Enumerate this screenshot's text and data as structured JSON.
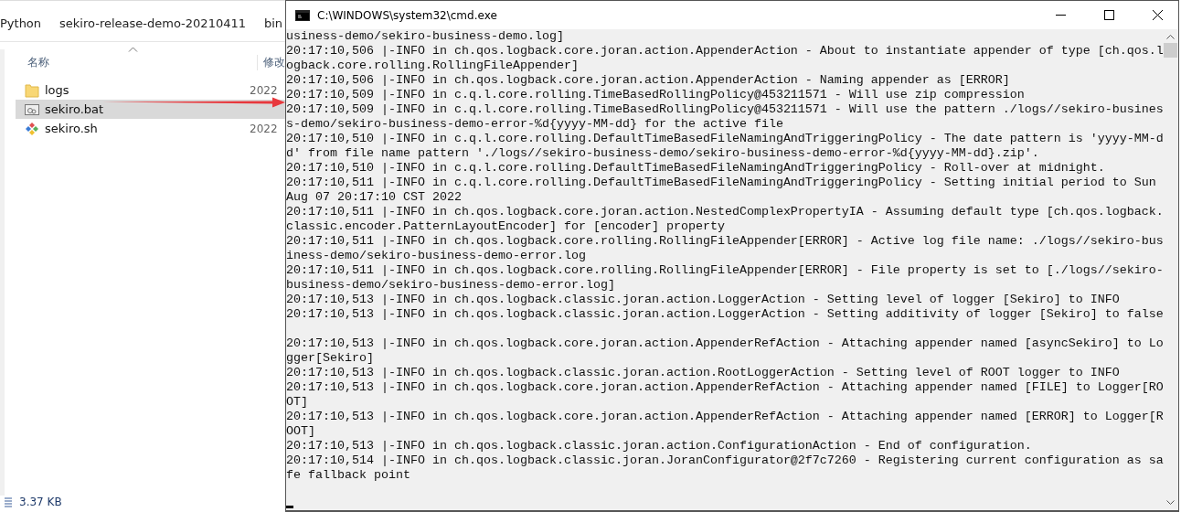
{
  "explorer": {
    "breadcrumb": [
      "Python",
      "sekiro-release-demo-20210411",
      "bin"
    ],
    "columns": [
      "名称",
      "修改"
    ],
    "files": [
      {
        "kind": "folder",
        "name": "logs",
        "date": "2022",
        "selected": false
      },
      {
        "kind": "bat",
        "name": "sekiro.bat",
        "selected": true
      },
      {
        "kind": "sh",
        "name": "sekiro.sh",
        "date": "2022",
        "selected": false
      }
    ],
    "status_bar": "3.37 KB"
  },
  "console": {
    "title": "C:\\WINDOWS\\system32\\cmd.exe",
    "lines": [
      {
        "kind": "text",
        "text": "usiness-demo/sekiro-business-demo.log]"
      },
      {
        "kind": "text",
        "text": "20:17:10,506 |-INFO in ch.qos.logback.core.joran.action.AppenderAction - About to instantiate appender of type [ch.qos.l"
      },
      {
        "kind": "text",
        "text": "ogback.core.rolling.RollingFileAppender]"
      },
      {
        "kind": "text",
        "text": "20:17:10,506 |-INFO in ch.qos.logback.core.joran.action.AppenderAction - Naming appender as [ERROR]"
      },
      {
        "kind": "text",
        "text": "20:17:10,509 |-INFO in c.q.l.core.rolling.TimeBasedRollingPolicy@453211571 - Will use zip compression"
      },
      {
        "kind": "text",
        "text": "20:17:10,509 |-INFO in c.q.l.core.rolling.TimeBasedRollingPolicy@453211571 - Will use the pattern ./logs//sekiro-busines"
      },
      {
        "kind": "text",
        "text": "s-demo/sekiro-business-demo-error-%d{yyyy-MM-dd} for the active file"
      },
      {
        "kind": "text",
        "text": "20:17:10,510 |-INFO in c.q.l.core.rolling.DefaultTimeBasedFileNamingAndTriggeringPolicy - The date pattern is 'yyyy-MM-d"
      },
      {
        "kind": "text",
        "text": "d' from file name pattern './logs//sekiro-business-demo/sekiro-business-demo-error-%d{yyyy-MM-dd}.zip'."
      },
      {
        "kind": "text",
        "text": "20:17:10,510 |-INFO in c.q.l.core.rolling.DefaultTimeBasedFileNamingAndTriggeringPolicy - Roll-over at midnight."
      },
      {
        "kind": "text",
        "text": "20:17:10,511 |-INFO in c.q.l.core.rolling.DefaultTimeBasedFileNamingAndTriggeringPolicy - Setting initial period to Sun"
      },
      {
        "kind": "text",
        "text": "Aug 07 20:17:10 CST 2022"
      },
      {
        "kind": "text",
        "text": "20:17:10,511 |-INFO in ch.qos.logback.core.joran.action.NestedComplexPropertyIA - Assuming default type [ch.qos.logback."
      },
      {
        "kind": "text",
        "text": "classic.encoder.PatternLayoutEncoder] for [encoder] property"
      },
      {
        "kind": "text",
        "text": "20:17:10,511 |-INFO in ch.qos.logback.core.rolling.RollingFileAppender[ERROR] - Active log file name: ./logs//sekiro-bus"
      },
      {
        "kind": "text",
        "text": "iness-demo/sekiro-business-demo-error.log"
      },
      {
        "kind": "text",
        "text": "20:17:10,511 |-INFO in ch.qos.logback.core.rolling.RollingFileAppender[ERROR] - File property is set to [./logs//sekiro-"
      },
      {
        "kind": "text",
        "text": "business-demo/sekiro-business-demo-error.log]"
      },
      {
        "kind": "text",
        "text": "20:17:10,513 |-INFO in ch.qos.logback.classic.joran.action.LoggerAction - Setting level of logger [Sekiro] to INFO"
      },
      {
        "kind": "text",
        "text": "20:17:10,513 |-INFO in ch.qos.logback.classic.joran.action.LoggerAction - Setting additivity of logger [Sekiro] to false"
      },
      {
        "kind": "blank"
      },
      {
        "kind": "text",
        "text": "20:17:10,513 |-INFO in ch.qos.logback.core.joran.action.AppenderRefAction - Attaching appender named [asyncSekiro] to Lo"
      },
      {
        "kind": "text",
        "text": "gger[Sekiro]"
      },
      {
        "kind": "text",
        "text": "20:17:10,513 |-INFO in ch.qos.logback.classic.joran.action.RootLoggerAction - Setting level of ROOT logger to INFO"
      },
      {
        "kind": "text",
        "text": "20:17:10,513 |-INFO in ch.qos.logback.core.joran.action.AppenderRefAction - Attaching appender named [FILE] to Logger[RO"
      },
      {
        "kind": "text",
        "text": "OT]"
      },
      {
        "kind": "text",
        "text": "20:17:10,513 |-INFO in ch.qos.logback.core.joran.action.AppenderRefAction - Attaching appender named [ERROR] to Logger[R"
      },
      {
        "kind": "text",
        "text": "OOT]"
      },
      {
        "kind": "text",
        "text": "20:17:10,513 |-INFO in ch.qos.logback.classic.joran.action.ConfigurationAction - End of configuration."
      },
      {
        "kind": "text",
        "text": "20:17:10,514 |-INFO in ch.qos.logback.classic.joran.JoranConfigurator@2f7c7260 - Registering current configuration as sa"
      },
      {
        "kind": "text",
        "text": "fe fallback point"
      }
    ]
  }
}
